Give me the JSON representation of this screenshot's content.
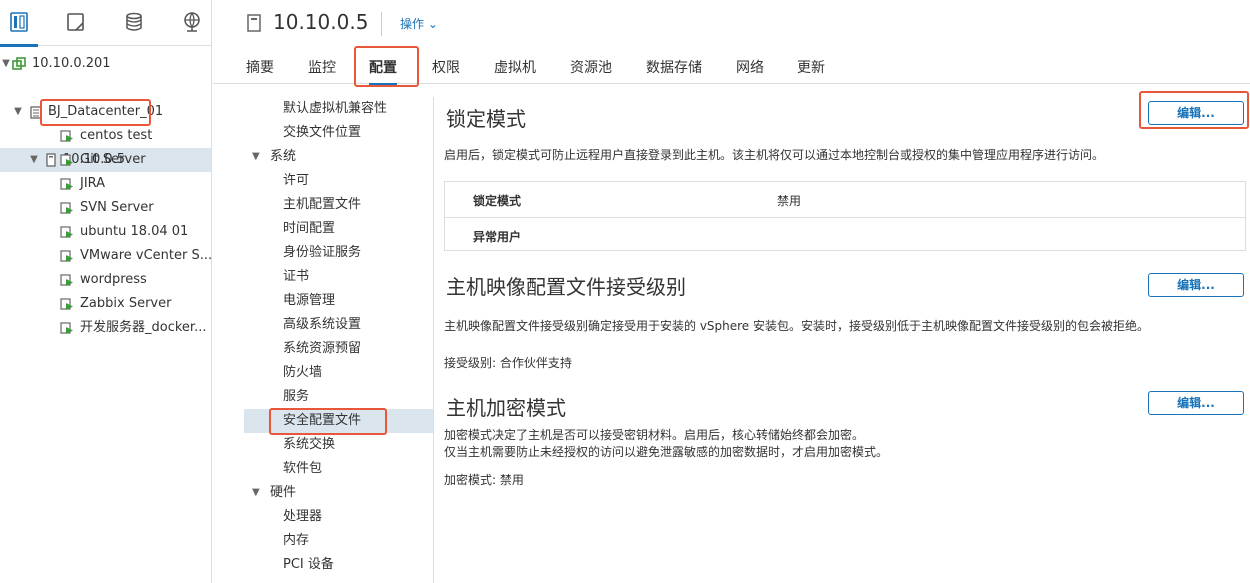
{
  "left_tabs": [
    {
      "icon": "hosts-and-clusters-icon"
    },
    {
      "icon": "vms-and-templates-icon"
    },
    {
      "icon": "storage-icon"
    },
    {
      "icon": "networking-icon"
    }
  ],
  "tree": {
    "vcenter": "10.10.0.201",
    "datacenter": "BJ_Datacenter_01",
    "host": "10.10.0.5",
    "vms": [
      "centos test",
      "Git Server",
      "JIRA",
      "SVN Server",
      "ubuntu 18.04 01",
      "VMware vCenter S...",
      "wordpress",
      "Zabbix Server",
      "开发服务器_docker..."
    ]
  },
  "header": {
    "title": "10.10.0.5",
    "actions_label": "操作"
  },
  "tabs": [
    "摘要",
    "监控",
    "配置",
    "权限",
    "虚拟机",
    "资源池",
    "数据存储",
    "网络",
    "更新"
  ],
  "active_tab": "配置",
  "subnav": [
    {
      "label": "默认虚拟机兼容性",
      "type": "item"
    },
    {
      "label": "交换文件位置",
      "type": "item"
    },
    {
      "label": "系统",
      "type": "group"
    },
    {
      "label": "许可",
      "type": "item"
    },
    {
      "label": "主机配置文件",
      "type": "item"
    },
    {
      "label": "时间配置",
      "type": "item"
    },
    {
      "label": "身份验证服务",
      "type": "item"
    },
    {
      "label": "证书",
      "type": "item"
    },
    {
      "label": "电源管理",
      "type": "item"
    },
    {
      "label": "高级系统设置",
      "type": "item"
    },
    {
      "label": "系统资源预留",
      "type": "item"
    },
    {
      "label": "防火墙",
      "type": "item"
    },
    {
      "label": "服务",
      "type": "item"
    },
    {
      "label": "安全配置文件",
      "type": "item",
      "selected": true
    },
    {
      "label": "系统交换",
      "type": "item"
    },
    {
      "label": "软件包",
      "type": "item"
    },
    {
      "label": "硬件",
      "type": "group"
    },
    {
      "label": "处理器",
      "type": "item"
    },
    {
      "label": "内存",
      "type": "item"
    },
    {
      "label": "PCI 设备",
      "type": "item"
    }
  ],
  "lockdown": {
    "title": "锁定模式",
    "edit_label": "编辑...",
    "description": "启用后，锁定模式可防止远程用户直接登录到此主机。该主机将仅可以通过本地控制台或授权的集中管理应用程序进行访问。",
    "rows": [
      {
        "key": "锁定模式",
        "value": "禁用"
      },
      {
        "key": "异常用户",
        "value": ""
      }
    ]
  },
  "image_profile": {
    "title": "主机映像配置文件接受级别",
    "edit_label": "编辑...",
    "description": "主机映像配置文件接受级别确定接受用于安装的 vSphere 安装包。安装时，接受级别低于主机映像配置文件接受级别的包会被拒绝。",
    "level_text": "接受级别: 合作伙伴支持"
  },
  "encryption": {
    "title": "主机加密模式",
    "edit_label": "编辑...",
    "description_line1": "加密模式决定了主机是否可以接受密钥材料。启用后，核心转储始终都会加密。",
    "description_line2": "仅当主机需要防止未经授权的访问以避免泄露敏感的加密数据时，才启用加密模式。",
    "mode_text": "加密模式: 禁用"
  },
  "colors": {
    "accent": "#1a73b8",
    "highlight": "#e8573a",
    "selected_bg": "#dbe5ee",
    "vm_running": "#3d9b35"
  }
}
